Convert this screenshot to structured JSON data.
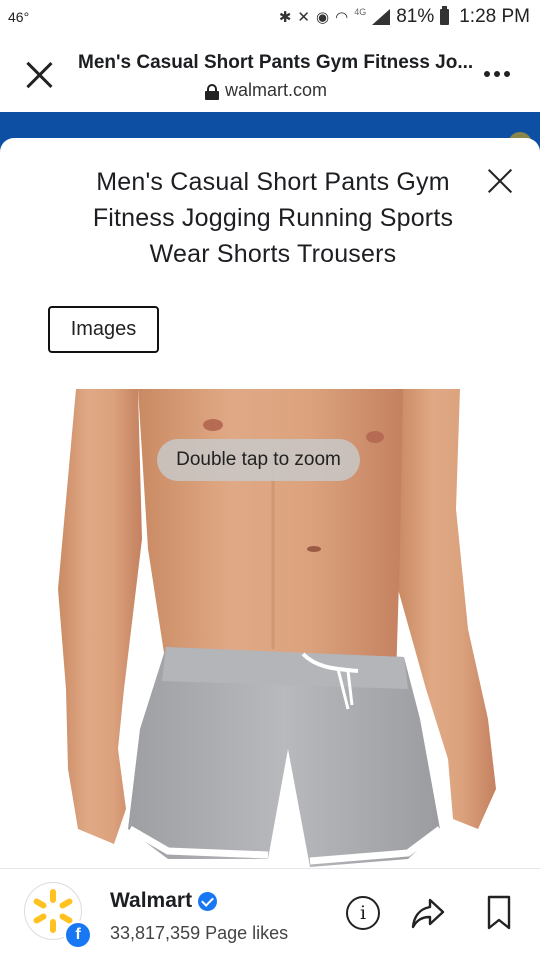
{
  "status_bar": {
    "temperature": "46°",
    "network": "4G",
    "battery": "81%",
    "time": "1:28 PM"
  },
  "browser": {
    "title": "Men's Casual Short Pants Gym Fitness Jo...",
    "url": "walmart.com"
  },
  "sheet": {
    "product_title": "Men's Casual Short Pants Gym Fitness Jogging Running Sports Wear Shorts Trousers",
    "images_button": "Images",
    "zoom_hint": "Double tap to zoom"
  },
  "footer": {
    "page_name": "Walmart",
    "page_likes": "33,817,359 Page likes",
    "badge_letter": "f"
  },
  "colors": {
    "facebook_blue": "#1877f2",
    "walmart_blue": "#0d4fa3",
    "walmart_yellow": "#ffc220",
    "shorts_gray": "#a9abaf"
  },
  "icons": [
    "bluetooth-icon",
    "mute-icon",
    "alarm-icon",
    "wifi-icon",
    "signal-icon",
    "battery-icon",
    "close-icon",
    "lock-icon",
    "more-icon",
    "verified-icon",
    "info-icon",
    "share-icon",
    "bookmark-icon"
  ]
}
